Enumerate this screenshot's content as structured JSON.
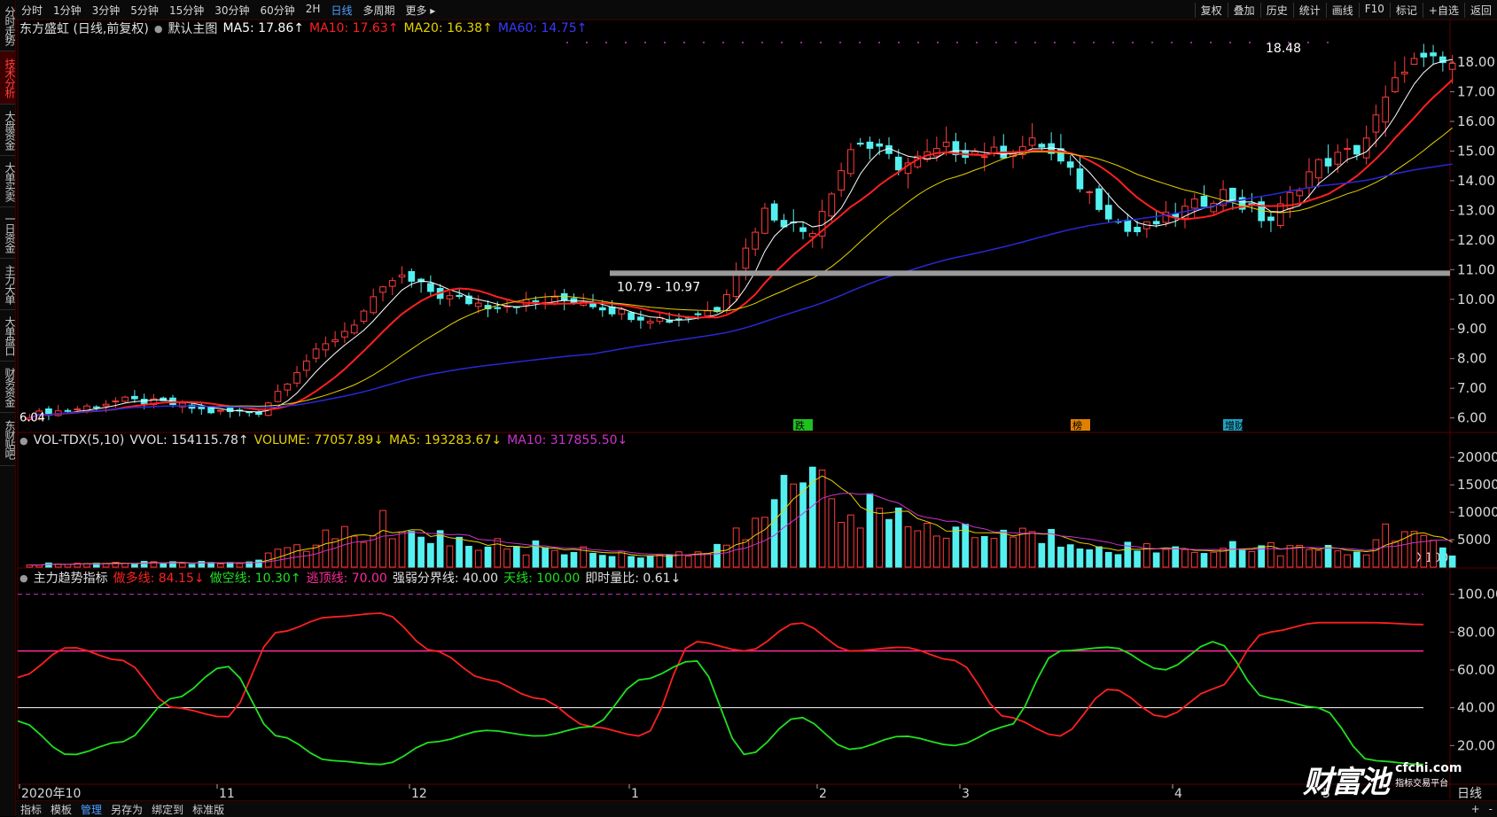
{
  "sidebar": {
    "items": [
      {
        "label": "分时走势",
        "active": false
      },
      {
        "label": "技术分析",
        "active": true
      },
      {
        "label": "大盘资金",
        "active": false
      },
      {
        "label": "大单买卖",
        "active": false
      },
      {
        "label": "一日资金",
        "active": false
      },
      {
        "label": "主力大单",
        "active": false
      },
      {
        "label": "大单盘口",
        "active": false
      },
      {
        "label": "财务资金",
        "active": false
      },
      {
        "label": "东财贴吧",
        "active": false
      }
    ]
  },
  "toolbar": {
    "periods": [
      {
        "label": "分时",
        "active": false
      },
      {
        "label": "1分钟",
        "active": false
      },
      {
        "label": "3分钟",
        "active": false
      },
      {
        "label": "5分钟",
        "active": false
      },
      {
        "label": "15分钟",
        "active": false
      },
      {
        "label": "30分钟",
        "active": false
      },
      {
        "label": "60分钟",
        "active": false
      },
      {
        "label": "2H",
        "active": false
      },
      {
        "label": "日线",
        "active": true
      },
      {
        "label": "多周期",
        "active": false
      },
      {
        "label": "更多 ▸",
        "active": false
      }
    ],
    "tools": [
      "复权",
      "叠加",
      "历史",
      "统计",
      "画线",
      "F10",
      "标记",
      "+自选",
      "返回"
    ]
  },
  "main_header": {
    "stock": "东方盛虹 (日线,前复权)",
    "template": "默认主图",
    "ma5": "MA5: 17.86↑",
    "ma10": "MA10: 17.63↑",
    "ma20": "MA20: 16.38↑",
    "ma60": "MA60: 14.75↑"
  },
  "vol_header": {
    "name": "VOL-TDX(5,10)",
    "vvol": "VVOL: 154115.78↑",
    "volume": "VOLUME: 77057.89↓",
    "ma5": "MA5: 193283.67↓",
    "ma10": "MA10: 317855.50↓"
  },
  "ind_header": {
    "name": "主力趋势指标",
    "long": "做多线: 84.15↓",
    "short": "做空线: 10.30↑",
    "escape": "逃顶线: 70.00",
    "boundary": "强弱分界线: 40.00",
    "sky": "天线: 100.00",
    "ratio": "即时量比: 0.61↓"
  },
  "price_axis": [
    "18.00",
    "17.00",
    "16.00",
    "15.00",
    "14.00",
    "13.00",
    "12.00",
    "11.00",
    "10.00",
    "9.00",
    "8.00",
    "7.00",
    "6.00"
  ],
  "vol_axis": [
    "20000",
    "15000",
    "10000",
    "5000"
  ],
  "vol_unit": "X100",
  "ind_axis": [
    "100.00",
    "80.00",
    "60.00",
    "40.00",
    "20.00"
  ],
  "x_axis": [
    "2020年10",
    "11",
    "12",
    "1",
    "2",
    "3",
    "4",
    "5"
  ],
  "x_axis_right": "日线",
  "annotations": {
    "high": "18.48",
    "low": "6.04",
    "support": "10.79 - 10.97",
    "event1": "跌",
    "event2": "榜",
    "event3": "增财"
  },
  "bottom_bar": [
    {
      "label": "指标",
      "active": false
    },
    {
      "label": "模板",
      "active": false
    },
    {
      "label": "管理",
      "active": true
    },
    {
      "label": "另存为",
      "active": false
    },
    {
      "label": "绑定到",
      "active": false
    },
    {
      "label": "标准版",
      "active": false
    }
  ],
  "bottom_right": [
    "+",
    "-"
  ],
  "watermark": {
    "brand": "财富池",
    "domain": "cfchi.com",
    "slogan": "指标交易平台"
  },
  "colors": {
    "up": "#ff3b3b",
    "down": "#54f0f0",
    "ma5": "#ffffff",
    "ma10": "#ff2020",
    "ma20": "#e6d200",
    "ma60": "#2828d8",
    "long": "#ff2020",
    "short": "#20e020",
    "escape": "#ff2a9a",
    "boundary": "#ffffff",
    "sky": "#cc33cc",
    "vol_ma5": "#e6d200",
    "vol_ma10": "#cc33cc"
  },
  "chart_data": [
    {
      "type": "candlestick",
      "title": "东方盛虹 (日线,前复权)",
      "x": [
        "2020-10",
        "11",
        "12",
        "1",
        "2",
        "3",
        "4",
        "5"
      ],
      "ylim": [
        5.6,
        18.9
      ],
      "close_approx": [
        6.1,
        6.3,
        6.6,
        6.5,
        6.2,
        6.2,
        7.9,
        9.1,
        10.8,
        10.1,
        9.8,
        9.9,
        10.0,
        9.5,
        9.3,
        9.7,
        13.0,
        12.2,
        15.4,
        14.5,
        15.1,
        14.9,
        15.3,
        13.7,
        12.2,
        12.9,
        13.6,
        12.6,
        14.5,
        15.1,
        18.0,
        17.9
      ],
      "ma_last": {
        "MA5": 17.86,
        "MA10": 17.63,
        "MA20": 16.38,
        "MA60": 14.75
      },
      "high": 18.48,
      "low": 6.04
    },
    {
      "type": "bar",
      "title": "VOL-TDX(5,10)",
      "ylim": [
        0,
        21000
      ],
      "values_x100_approx": [
        500,
        600,
        900,
        700,
        800,
        1200,
        4500,
        6000,
        8000,
        5000,
        4000,
        3500,
        3000,
        2500,
        2200,
        3000,
        9000,
        19000,
        11000,
        7500,
        6500,
        6000,
        5500,
        4500,
        3500,
        3000,
        4000,
        3500,
        3000,
        2500,
        9000,
        1500
      ]
    },
    {
      "type": "line",
      "title": "主力趋势指标",
      "ylim": [
        0,
        105
      ],
      "series": [
        {
          "name": "做多线",
          "values": [
            56,
            72,
            65,
            40,
            35,
            80,
            88,
            90,
            70,
            55,
            45,
            30,
            25,
            75,
            70,
            85,
            70,
            72,
            65,
            35,
            25,
            50,
            35,
            50,
            80,
            85,
            85,
            84
          ]
        },
        {
          "name": "做空线",
          "values": [
            33,
            15,
            22,
            45,
            62,
            25,
            12,
            10,
            22,
            28,
            25,
            30,
            55,
            65,
            15,
            35,
            18,
            25,
            20,
            30,
            70,
            72,
            60,
            75,
            45,
            40,
            12,
            10
          ]
        }
      ],
      "levels": {
        "逃顶线": 70,
        "强弱分界线": 40,
        "天线": 100
      }
    }
  ]
}
